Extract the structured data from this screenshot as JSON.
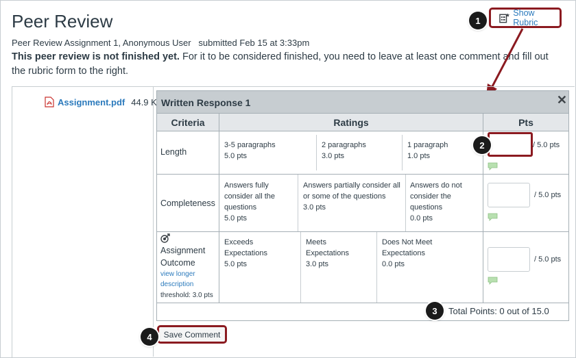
{
  "page": {
    "title": "Peer Review",
    "submission_line": "Peer Review Assignment 1, Anonymous User   submitted Feb 15 at 3:33pm",
    "notice_bold": "This peer review is not finished yet.",
    "notice_rest": " For it to be considered finished, you need to leave at least one comment and fill out the rubric form to the right."
  },
  "header": {
    "show_rubric_label": "Show Rubric",
    "icon": "rubric-icon"
  },
  "attachment": {
    "name": "Assignment.pdf",
    "size": "44.9 KB",
    "icon": "pdf-icon"
  },
  "rubric": {
    "title": "Written Response 1",
    "close_label": "✕",
    "columns": {
      "criteria": "Criteria",
      "ratings": "Ratings",
      "pts": "Pts"
    },
    "rows": [
      {
        "criterion": "Length",
        "ratings": [
          {
            "desc": "3-5 paragraphs",
            "pts": "5.0 pts"
          },
          {
            "desc": "2 paragraphs",
            "pts": "3.0 pts"
          },
          {
            "desc": "1 paragraph",
            "pts": "1.0 pts"
          }
        ],
        "pts_input": "",
        "out_of": "/ 5.0 pts"
      },
      {
        "criterion": "Completeness",
        "ratings": [
          {
            "desc": "Answers fully consider all the questions",
            "pts": "5.0 pts"
          },
          {
            "desc": "Answers partially consider all or some of the questions",
            "pts": "3.0 pts"
          },
          {
            "desc": "Answers do not consider the questions",
            "pts": "0.0 pts"
          }
        ],
        "pts_input": "",
        "out_of": "/ 5.0 pts"
      },
      {
        "criterion": "Assignment Outcome",
        "criterion_icon": "outcome-target-icon",
        "view_longer": "view longer description",
        "threshold": "threshold: 3.0 pts",
        "ratings": [
          {
            "desc": "Exceeds Expectations",
            "pts": "5.0 pts"
          },
          {
            "desc": "Meets Expectations",
            "pts": "3.0 pts"
          },
          {
            "desc": "Does Not Meet Expectations",
            "pts": "0.0 pts"
          }
        ],
        "pts_input": "",
        "out_of": "/ 5.0 pts"
      }
    ],
    "total": "Total Points: 0 out of 15.0"
  },
  "save_comment_label": "Save Comment",
  "callouts": [
    "1",
    "2",
    "3",
    "4"
  ],
  "colors": {
    "highlight": "#8b1a20",
    "link": "#2b7abc",
    "header_bg": "#c7cdd1",
    "comment_icon": "#b8e0b0"
  }
}
